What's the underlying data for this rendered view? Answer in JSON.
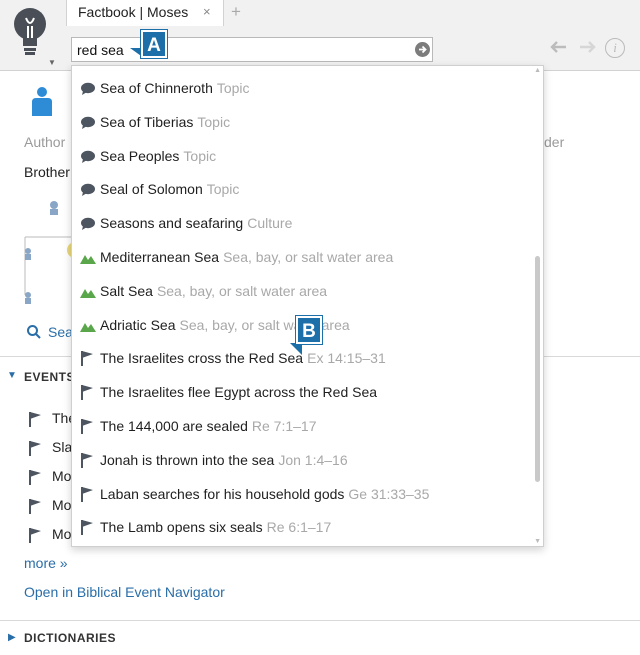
{
  "tab": {
    "title": "Factbook | Moses",
    "close": "×",
    "new": "+"
  },
  "search": {
    "value": "red sea"
  },
  "callouts": {
    "a": "A",
    "b": "B"
  },
  "background": {
    "author_label": "Author",
    "elder_label_partial": "der",
    "brother_text": "Brother",
    "search_partial": "Sea",
    "events_title": "EVENTS",
    "events_partial": [
      "The",
      "Sla",
      "Mo",
      "Mo",
      "Mo"
    ],
    "more_link": "more »",
    "open_nav_link": "Open in Biblical Event Navigator",
    "dictionaries_title": "DICTIONARIES"
  },
  "dropdown": {
    "items": [
      {
        "label": "Sea of Chinneroth",
        "type": "Topic",
        "icon": "speech-bubble-icon"
      },
      {
        "label": "Sea of Tiberias",
        "type": "Topic",
        "icon": "speech-bubble-icon"
      },
      {
        "label": "Sea Peoples",
        "type": "Topic",
        "icon": "speech-bubble-icon"
      },
      {
        "label": "Seal of Solomon",
        "type": "Topic",
        "icon": "speech-bubble-icon"
      },
      {
        "label": "Seasons and seafaring",
        "type": "Culture",
        "icon": "speech-bubble-icon"
      },
      {
        "label": "Mediterranean Sea",
        "type": "Sea, bay, or salt water area",
        "icon": "mountain-icon"
      },
      {
        "label": "Salt Sea",
        "type": "Sea, bay, or salt water area",
        "icon": "mountain-icon"
      },
      {
        "label": "Adriatic Sea",
        "type": "Sea, bay, or salt water area",
        "icon": "mountain-icon"
      },
      {
        "label": "The Israelites cross the Red Sea",
        "type": "Ex 14:15–31",
        "icon": "flag-icon"
      },
      {
        "label": "The Israelites flee Egypt across the Red Sea",
        "type": "",
        "icon": "flag-icon"
      },
      {
        "label": "The 144,000 are sealed",
        "type": "Re 7:1–17",
        "icon": "flag-icon"
      },
      {
        "label": "Jonah is thrown into the sea",
        "type": "Jon 1:4–16",
        "icon": "flag-icon"
      },
      {
        "label": "Laban searches for his household gods",
        "type": "Ge 31:33–35",
        "icon": "flag-icon"
      },
      {
        "label": "The Lamb opens six seals",
        "type": "Re 6:1–17",
        "icon": "flag-icon"
      }
    ]
  },
  "colors": {
    "link": "#2a6ea8",
    "callout": "#1c6fa8",
    "mountain": "#5aa64a",
    "icon_dark": "#4d5560"
  }
}
